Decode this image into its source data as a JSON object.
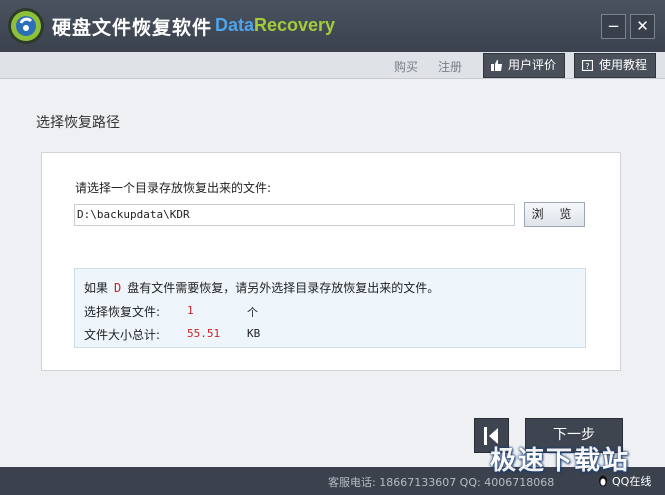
{
  "titlebar": {
    "title": "硬盘文件恢复软件",
    "brand_part1": "Data",
    "brand_part2": "Recovery",
    "minimize_glyph": "−",
    "close_glyph": "✕"
  },
  "toolbar": {
    "buy": "购买",
    "register": "注册",
    "review": "用户评价",
    "tutorial": "使用教程"
  },
  "section_title": "选择恢复路径",
  "panel": {
    "prompt": "请选择一个目录存放恢复出来的文件:",
    "path": "D:\\backupdata\\KDR",
    "browse": "浏 览"
  },
  "info": {
    "prefix": "如果",
    "drive": "D",
    "suffix": "盘有文件需要恢复，请另外选择目录存放恢复出来的文件。",
    "files_label": "选择恢复文件:",
    "files_count": "1",
    "files_unit": "个",
    "size_label": "文件大小总计:",
    "size_value": "55.51",
    "size_unit": "KB"
  },
  "nav": {
    "next": "下一步"
  },
  "statusbar": {
    "contact": "客服电话: 18667133607 QQ: 4006718068",
    "qq_online": "QQ在线"
  },
  "watermark": "极速下载站",
  "colors": {
    "titlebar": "#3b424e",
    "brand_blue": "#4fa3e8",
    "brand_green": "#a3cc3a",
    "highlight_red": "#cc2222",
    "info_bg": "#eef5fb"
  },
  "icons": {
    "app_logo": "data-recovery-logo-icon",
    "review": "thumbs-up-icon",
    "tutorial": "help-book-icon",
    "back": "back-arrow-icon",
    "qq": "penguin-icon"
  }
}
